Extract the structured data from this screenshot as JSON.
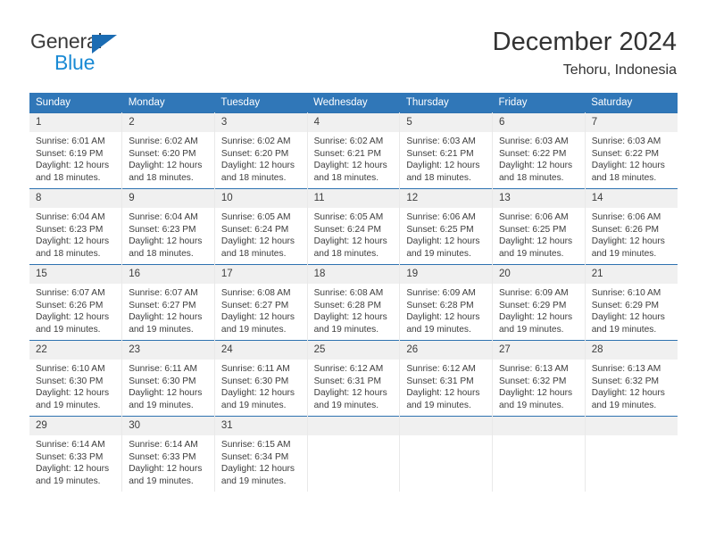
{
  "logo": {
    "word_top": "General",
    "word_bottom": "Blue",
    "triangle_icon": "triangle-icon",
    "color_dark": "#3b3b3b",
    "color_blue": "#1a8ad4",
    "color_triangle": "#1b6cb3"
  },
  "header": {
    "title": "December 2024",
    "subtitle": "Tehoru, Indonesia"
  },
  "theme": {
    "header_bg": "#3077b8",
    "row_rule": "#2e72b0",
    "daynum_bg": "#f0f0f0",
    "text": "#3d3d3d"
  },
  "weekdays": [
    "Sunday",
    "Monday",
    "Tuesday",
    "Wednesday",
    "Thursday",
    "Friday",
    "Saturday"
  ],
  "labels": {
    "sunrise_prefix": "Sunrise:",
    "sunset_prefix": "Sunset:",
    "daylight_prefix": "Daylight:"
  },
  "weeks": [
    [
      {
        "day": "1",
        "sunrise": "Sunrise: 6:01 AM",
        "sunset": "Sunset: 6:19 PM",
        "daylight1": "Daylight: 12 hours",
        "daylight2": "and 18 minutes."
      },
      {
        "day": "2",
        "sunrise": "Sunrise: 6:02 AM",
        "sunset": "Sunset: 6:20 PM",
        "daylight1": "Daylight: 12 hours",
        "daylight2": "and 18 minutes."
      },
      {
        "day": "3",
        "sunrise": "Sunrise: 6:02 AM",
        "sunset": "Sunset: 6:20 PM",
        "daylight1": "Daylight: 12 hours",
        "daylight2": "and 18 minutes."
      },
      {
        "day": "4",
        "sunrise": "Sunrise: 6:02 AM",
        "sunset": "Sunset: 6:21 PM",
        "daylight1": "Daylight: 12 hours",
        "daylight2": "and 18 minutes."
      },
      {
        "day": "5",
        "sunrise": "Sunrise: 6:03 AM",
        "sunset": "Sunset: 6:21 PM",
        "daylight1": "Daylight: 12 hours",
        "daylight2": "and 18 minutes."
      },
      {
        "day": "6",
        "sunrise": "Sunrise: 6:03 AM",
        "sunset": "Sunset: 6:22 PM",
        "daylight1": "Daylight: 12 hours",
        "daylight2": "and 18 minutes."
      },
      {
        "day": "7",
        "sunrise": "Sunrise: 6:03 AM",
        "sunset": "Sunset: 6:22 PM",
        "daylight1": "Daylight: 12 hours",
        "daylight2": "and 18 minutes."
      }
    ],
    [
      {
        "day": "8",
        "sunrise": "Sunrise: 6:04 AM",
        "sunset": "Sunset: 6:23 PM",
        "daylight1": "Daylight: 12 hours",
        "daylight2": "and 18 minutes."
      },
      {
        "day": "9",
        "sunrise": "Sunrise: 6:04 AM",
        "sunset": "Sunset: 6:23 PM",
        "daylight1": "Daylight: 12 hours",
        "daylight2": "and 18 minutes."
      },
      {
        "day": "10",
        "sunrise": "Sunrise: 6:05 AM",
        "sunset": "Sunset: 6:24 PM",
        "daylight1": "Daylight: 12 hours",
        "daylight2": "and 18 minutes."
      },
      {
        "day": "11",
        "sunrise": "Sunrise: 6:05 AM",
        "sunset": "Sunset: 6:24 PM",
        "daylight1": "Daylight: 12 hours",
        "daylight2": "and 18 minutes."
      },
      {
        "day": "12",
        "sunrise": "Sunrise: 6:06 AM",
        "sunset": "Sunset: 6:25 PM",
        "daylight1": "Daylight: 12 hours",
        "daylight2": "and 19 minutes."
      },
      {
        "day": "13",
        "sunrise": "Sunrise: 6:06 AM",
        "sunset": "Sunset: 6:25 PM",
        "daylight1": "Daylight: 12 hours",
        "daylight2": "and 19 minutes."
      },
      {
        "day": "14",
        "sunrise": "Sunrise: 6:06 AM",
        "sunset": "Sunset: 6:26 PM",
        "daylight1": "Daylight: 12 hours",
        "daylight2": "and 19 minutes."
      }
    ],
    [
      {
        "day": "15",
        "sunrise": "Sunrise: 6:07 AM",
        "sunset": "Sunset: 6:26 PM",
        "daylight1": "Daylight: 12 hours",
        "daylight2": "and 19 minutes."
      },
      {
        "day": "16",
        "sunrise": "Sunrise: 6:07 AM",
        "sunset": "Sunset: 6:27 PM",
        "daylight1": "Daylight: 12 hours",
        "daylight2": "and 19 minutes."
      },
      {
        "day": "17",
        "sunrise": "Sunrise: 6:08 AM",
        "sunset": "Sunset: 6:27 PM",
        "daylight1": "Daylight: 12 hours",
        "daylight2": "and 19 minutes."
      },
      {
        "day": "18",
        "sunrise": "Sunrise: 6:08 AM",
        "sunset": "Sunset: 6:28 PM",
        "daylight1": "Daylight: 12 hours",
        "daylight2": "and 19 minutes."
      },
      {
        "day": "19",
        "sunrise": "Sunrise: 6:09 AM",
        "sunset": "Sunset: 6:28 PM",
        "daylight1": "Daylight: 12 hours",
        "daylight2": "and 19 minutes."
      },
      {
        "day": "20",
        "sunrise": "Sunrise: 6:09 AM",
        "sunset": "Sunset: 6:29 PM",
        "daylight1": "Daylight: 12 hours",
        "daylight2": "and 19 minutes."
      },
      {
        "day": "21",
        "sunrise": "Sunrise: 6:10 AM",
        "sunset": "Sunset: 6:29 PM",
        "daylight1": "Daylight: 12 hours",
        "daylight2": "and 19 minutes."
      }
    ],
    [
      {
        "day": "22",
        "sunrise": "Sunrise: 6:10 AM",
        "sunset": "Sunset: 6:30 PM",
        "daylight1": "Daylight: 12 hours",
        "daylight2": "and 19 minutes."
      },
      {
        "day": "23",
        "sunrise": "Sunrise: 6:11 AM",
        "sunset": "Sunset: 6:30 PM",
        "daylight1": "Daylight: 12 hours",
        "daylight2": "and 19 minutes."
      },
      {
        "day": "24",
        "sunrise": "Sunrise: 6:11 AM",
        "sunset": "Sunset: 6:30 PM",
        "daylight1": "Daylight: 12 hours",
        "daylight2": "and 19 minutes."
      },
      {
        "day": "25",
        "sunrise": "Sunrise: 6:12 AM",
        "sunset": "Sunset: 6:31 PM",
        "daylight1": "Daylight: 12 hours",
        "daylight2": "and 19 minutes."
      },
      {
        "day": "26",
        "sunrise": "Sunrise: 6:12 AM",
        "sunset": "Sunset: 6:31 PM",
        "daylight1": "Daylight: 12 hours",
        "daylight2": "and 19 minutes."
      },
      {
        "day": "27",
        "sunrise": "Sunrise: 6:13 AM",
        "sunset": "Sunset: 6:32 PM",
        "daylight1": "Daylight: 12 hours",
        "daylight2": "and 19 minutes."
      },
      {
        "day": "28",
        "sunrise": "Sunrise: 6:13 AM",
        "sunset": "Sunset: 6:32 PM",
        "daylight1": "Daylight: 12 hours",
        "daylight2": "and 19 minutes."
      }
    ],
    [
      {
        "day": "29",
        "sunrise": "Sunrise: 6:14 AM",
        "sunset": "Sunset: 6:33 PM",
        "daylight1": "Daylight: 12 hours",
        "daylight2": "and 19 minutes."
      },
      {
        "day": "30",
        "sunrise": "Sunrise: 6:14 AM",
        "sunset": "Sunset: 6:33 PM",
        "daylight1": "Daylight: 12 hours",
        "daylight2": "and 19 minutes."
      },
      {
        "day": "31",
        "sunrise": "Sunrise: 6:15 AM",
        "sunset": "Sunset: 6:34 PM",
        "daylight1": "Daylight: 12 hours",
        "daylight2": "and 19 minutes."
      },
      {
        "day": "",
        "sunrise": "",
        "sunset": "",
        "daylight1": "",
        "daylight2": ""
      },
      {
        "day": "",
        "sunrise": "",
        "sunset": "",
        "daylight1": "",
        "daylight2": ""
      },
      {
        "day": "",
        "sunrise": "",
        "sunset": "",
        "daylight1": "",
        "daylight2": ""
      },
      {
        "day": "",
        "sunrise": "",
        "sunset": "",
        "daylight1": "",
        "daylight2": ""
      }
    ]
  ]
}
